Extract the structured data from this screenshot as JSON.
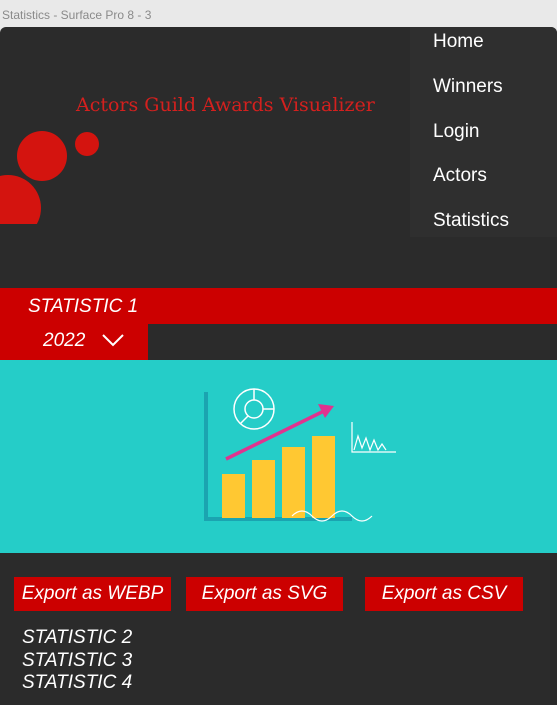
{
  "window": {
    "title": "Statistics - Surface Pro 8 - 3"
  },
  "header": {
    "app_title": "Actors Guild Awards Visualizer"
  },
  "nav": {
    "items": [
      {
        "label": "Home"
      },
      {
        "label": "Winners"
      },
      {
        "label": "Login"
      },
      {
        "label": "Actors"
      },
      {
        "label": "Statistics"
      }
    ]
  },
  "statistic": {
    "title": "STATISTIC 1",
    "year": "2022",
    "chart_illustration_icon": "bar-chart-illustration-icon"
  },
  "export": {
    "webp_label": "Export as WEBP",
    "svg_label": "Export as SVG",
    "csv_label": "Export as CSV"
  },
  "more_statistics": [
    {
      "label": "STATISTIC 2"
    },
    {
      "label": "STATISTIC 3"
    },
    {
      "label": "STATISTIC 4"
    }
  ],
  "colors": {
    "accent_red": "#cc0000",
    "background": "#2b2b2b",
    "illustration_bg": "#25cdc8",
    "bar_yellow": "#ffc832",
    "arrow_pink": "#e0338f"
  }
}
